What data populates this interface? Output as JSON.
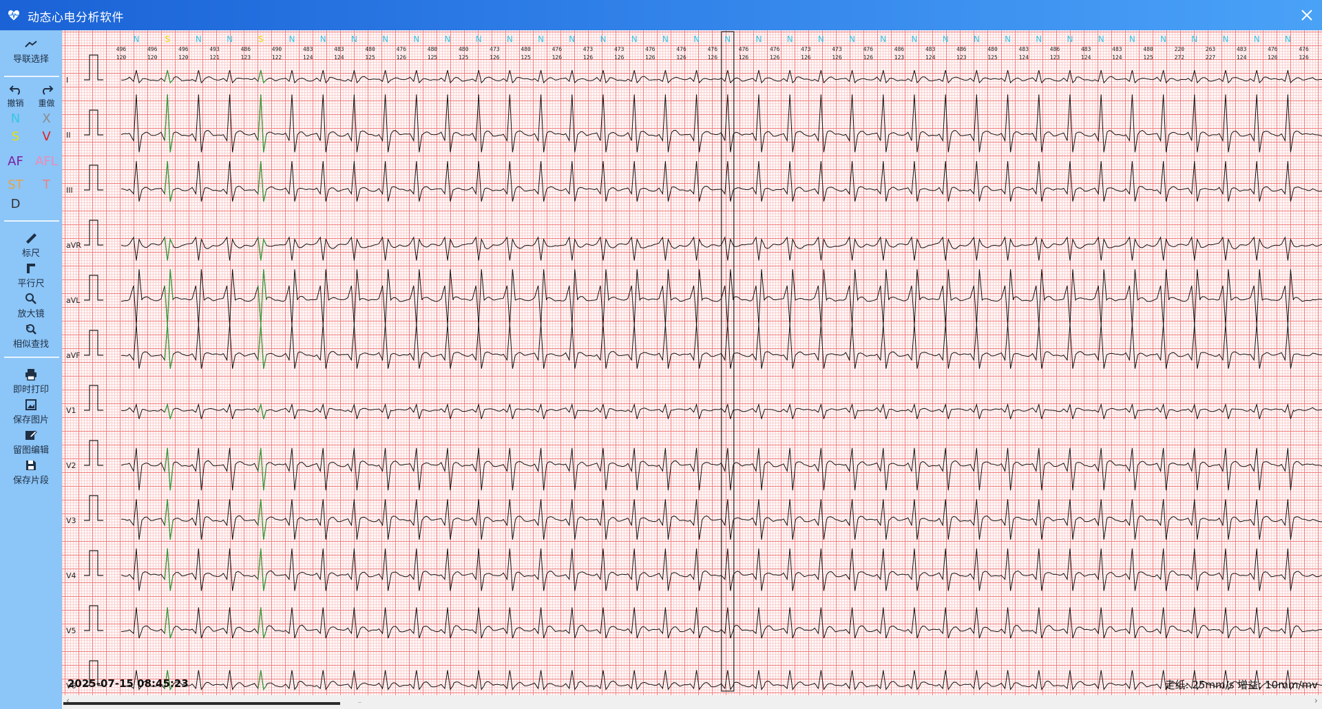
{
  "window": {
    "title": "动态心电分析软件",
    "close_icon": "close-icon",
    "app_icon": "heart-icon"
  },
  "sidebar": {
    "lead_select": {
      "label": "导联选择",
      "icon": "lead-select-icon"
    },
    "undo": {
      "label": "撤销",
      "icon": "undo-icon"
    },
    "redo": {
      "label": "重做",
      "icon": "redo-icon"
    },
    "beat_types": [
      {
        "label": "N",
        "color": "#35c6e6"
      },
      {
        "label": "X",
        "color": "#8a8a8a"
      },
      {
        "label": "S",
        "color": "#e8e000"
      },
      {
        "label": "V",
        "color": "#e11e1e"
      },
      {
        "label": "AF",
        "color": "#7a1fa2"
      },
      {
        "label": "AFL",
        "color": "#f08ab5"
      },
      {
        "label": "ST",
        "color": "#e6a34a"
      },
      {
        "label": "T",
        "color": "#f08080"
      },
      {
        "label": "D",
        "color": "#333333"
      }
    ],
    "tools": [
      {
        "label": "标尺",
        "icon": "ruler-icon"
      },
      {
        "label": "平行尺",
        "icon": "parallel-ruler-icon"
      },
      {
        "label": "放大镜",
        "icon": "magnifier-icon"
      },
      {
        "label": "相似查找",
        "icon": "similar-search-icon"
      }
    ],
    "actions": [
      {
        "label": "即时打印",
        "icon": "print-icon"
      },
      {
        "label": "保存图片",
        "icon": "image-icon"
      },
      {
        "label": "留图编辑",
        "icon": "edit-icon"
      },
      {
        "label": "保存片段",
        "icon": "save-icon"
      }
    ]
  },
  "ecg": {
    "leads": [
      "I",
      "II",
      "III",
      "aVR",
      "aVL",
      "aVF",
      "V1",
      "V2",
      "V3",
      "V4",
      "V5",
      "V6"
    ],
    "beat_labels": [
      "N",
      "S",
      "N",
      "N",
      "S",
      "N",
      "N",
      "N",
      "N",
      "N",
      "N",
      "N",
      "N",
      "N",
      "N",
      "N",
      "N",
      "N",
      "N",
      "N",
      "N",
      "N",
      "N",
      "N",
      "N",
      "N",
      "N",
      "N",
      "N",
      "N",
      "N",
      "N",
      "N",
      "N",
      "N",
      "N",
      "N",
      "N"
    ],
    "rr_intervals": [
      "496",
      "496",
      "496",
      "493",
      "486",
      "490",
      "483",
      "483",
      "480",
      "476",
      "480",
      "480",
      "473",
      "480",
      "476",
      "473",
      "473",
      "476",
      "476",
      "476",
      "476",
      "476",
      "473",
      "473",
      "476",
      "486",
      "483",
      "486",
      "480",
      "483",
      "486",
      "483",
      "483",
      "480",
      "220",
      "263",
      "483",
      "476",
      "476"
    ],
    "heart_rates": [
      "120",
      "120",
      "120",
      "121",
      "123",
      "122",
      "124",
      "124",
      "125",
      "126",
      "125",
      "125",
      "126",
      "125",
      "126",
      "126",
      "126",
      "126",
      "126",
      "126",
      "126",
      "126",
      "126",
      "126",
      "126",
      "123",
      "124",
      "123",
      "125",
      "124",
      "123",
      "124",
      "124",
      "125",
      "272",
      "227",
      "124",
      "126",
      "126"
    ],
    "beat_colors": {
      "N": "#35c6e6",
      "S": "#e8e000"
    },
    "selected_beat_index": 19,
    "timestamp": "2025-07-15 08:45:23",
    "paper_speed_label": "走纸:",
    "paper_speed": "25mm/s",
    "gain_label": "增益:",
    "gain": "10mm/mv"
  }
}
